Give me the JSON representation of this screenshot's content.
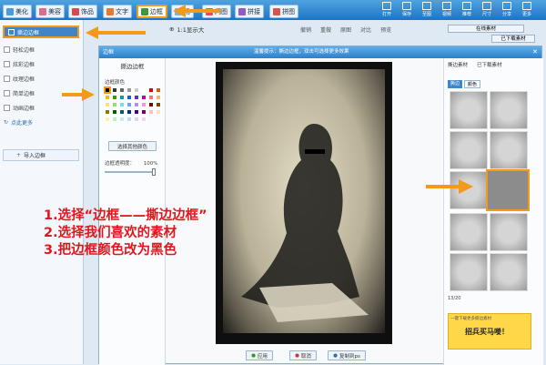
{
  "topbar": {
    "tabs": [
      {
        "label": "美化",
        "color": "#4c9be0"
      },
      {
        "label": "美容",
        "color": "#e06b8c"
      },
      {
        "label": "饰品",
        "color": "#d64a4a"
      },
      {
        "label": "文字",
        "color": "#e87a30"
      },
      {
        "label": "边框",
        "color": "#3a9a3a",
        "active": true
      },
      {
        "label": "场",
        "color": "#7bb3df"
      },
      {
        "label": "闪图",
        "color": "#e05050"
      },
      {
        "label": "拼接",
        "color": "#8f5cc0"
      },
      {
        "label": "拼图",
        "color": "#d9534f"
      }
    ],
    "tools": [
      "打开",
      "保存",
      "至图",
      "视频",
      "推荐",
      "尺寸",
      "分享",
      "更多"
    ]
  },
  "sidebar": {
    "items": [
      "撕边边框",
      "轻松边框",
      "炫彩边框",
      "纹理边框",
      "简单边框",
      "动画边框",
      "点此更多"
    ],
    "import_label": "导入边框"
  },
  "toolbar_zoom": {
    "label": "1:1显示大"
  },
  "toolbar_actions": [
    "撤销",
    "重做",
    "原图",
    "对比",
    "预览"
  ],
  "dialog": {
    "title": "边框",
    "title_note": "温馨提示：撕边边框，双击可选择更多效果",
    "left_panel_title": "撕边边框",
    "color_label": "边框颜色",
    "transparency_label": "边框透明度：",
    "transparency_value": "100%",
    "reset_label": "选择其他颜色",
    "swatch_colors": [
      "#000000",
      "#333333",
      "#666666",
      "#999999",
      "#cccccc",
      "#ffffff",
      "#e00000",
      "#e05a00",
      "#e6c200",
      "#3a9a00",
      "#00a0a0",
      "#1060e0",
      "#6030c0",
      "#c000a0",
      "#ff7070",
      "#ffb070",
      "#ffe070",
      "#90e070",
      "#70e0e0",
      "#70a0ff",
      "#b090ff",
      "#ff90e0",
      "#800000",
      "#804000",
      "#808000",
      "#006000",
      "#006060",
      "#003080",
      "#400080",
      "#800060",
      "#ffc0c0",
      "#ffe0c0",
      "#fff0b0",
      "#c0f0c0",
      "#c0f0f0",
      "#c0d8ff",
      "#e0d0ff",
      "#ffd0f0"
    ],
    "right_panel_tabs": [
      "撕边素材",
      "已下载素材"
    ],
    "right_top_buttons": [
      "在线素材",
      "已下载素材"
    ],
    "filter_tabs": [
      "撕边",
      "颜色"
    ],
    "pager": "13/20",
    "ad_text": "招兵买马喽！",
    "ad_sub": "一键下载更多撕边素材"
  },
  "instructions": [
    "1.选择“边框——撕边边框”",
    "2.选择我们喜欢的素材",
    "3.把边框颜色改为黑色"
  ],
  "bottom_buttons": [
    "应用",
    "取消",
    "复制到ps"
  ],
  "accent": "#f39a1a",
  "arrow_color": "#f39a1a"
}
